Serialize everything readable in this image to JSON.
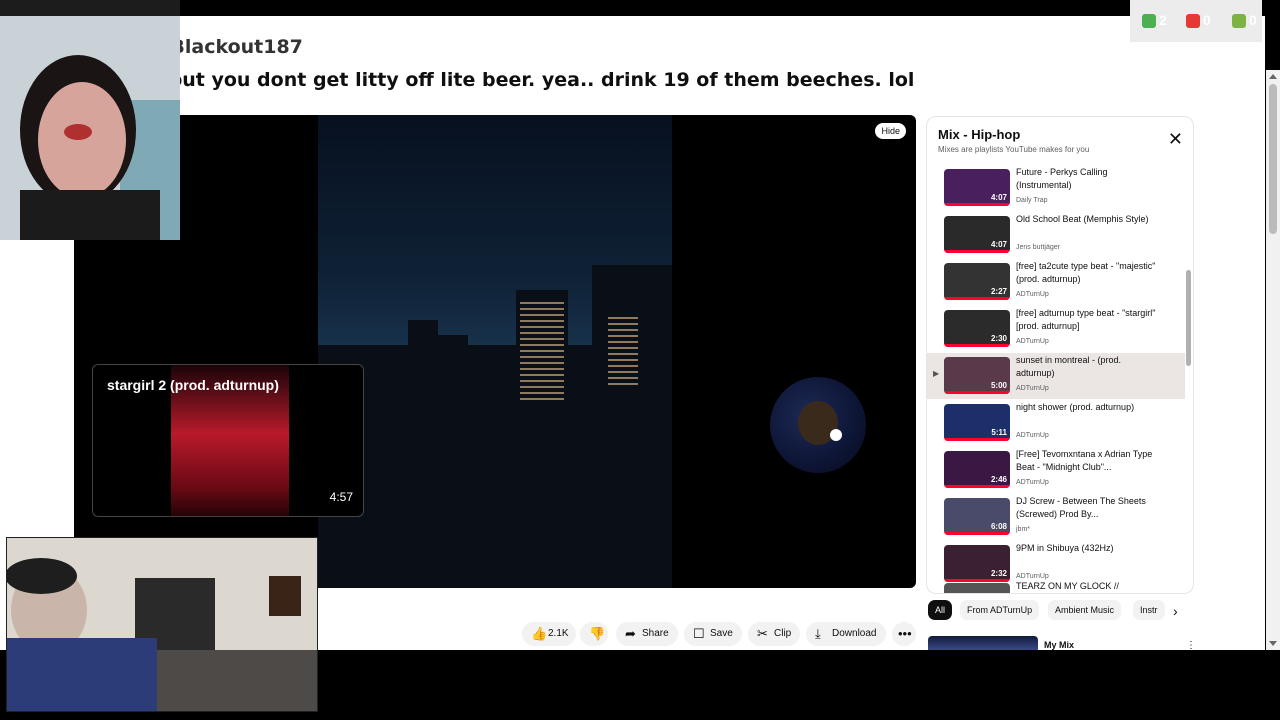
{
  "tweet": {
    "handle": "@TheBlackout187",
    "text": "Blackout you dont get litty off lite beer. yea.. drink 19 of them beeches. lol"
  },
  "stats": {
    "views": "2",
    "subs": "0",
    "links": "0"
  },
  "player": {
    "hide_label": "Hide",
    "mini_title": "stargirl 2 (prod. adturnup)",
    "mini_duration": "4:57"
  },
  "actions": {
    "likes": "2.1K",
    "share": "Share",
    "save": "Save",
    "clip": "Clip",
    "download": "Download"
  },
  "playlist": {
    "title": "Mix - Hip-hop",
    "subtitle": "Mixes are playlists YouTube makes for you",
    "items": [
      {
        "title": "Future - Perkys Calling (Instrumental)",
        "channel": "Daily Trap",
        "duration": "4:07"
      },
      {
        "title": "Old School Beat (Memphis Style)",
        "channel": "Jens buttjäger",
        "duration": "4:07"
      },
      {
        "title": "[free] ta2cute type beat - \"majestic\" (prod. adturnup)",
        "channel": "ADTurnUp",
        "duration": "2:27"
      },
      {
        "title": "[free] adturnup type beat - \"stargirl\" [prod. adturnup]",
        "channel": "ADTurnUp",
        "duration": "2:30"
      },
      {
        "title": "sunset in montreal - (prod. adturnup)",
        "channel": "ADTurnUp",
        "duration": "5:00"
      },
      {
        "title": "night shower (prod. adturnup)",
        "channel": "ADTurnUp",
        "duration": "5:11"
      },
      {
        "title": "[Free] Tevomxntana x Adrian Type Beat - \"Midnight Club\"...",
        "channel": "ADTurnUp",
        "duration": "2:46"
      },
      {
        "title": "DJ Screw - Between The Sheets (Screwed) Prod By...",
        "channel": "jbm*",
        "duration": "6:08"
      },
      {
        "title": "9PM in Shibuya (432Hz)",
        "channel": "ADTurnUp",
        "duration": "2:32"
      },
      {
        "title": "TEARZ ON MY GLOCK //",
        "channel": "",
        "duration": ""
      }
    ]
  },
  "chips": [
    "All",
    "From ADTurnUp",
    "Ambient Music",
    "Instr"
  ],
  "next": {
    "title": "My Mix"
  },
  "colors": {
    "accent": "#ff0033",
    "brand": "#ff0000"
  }
}
